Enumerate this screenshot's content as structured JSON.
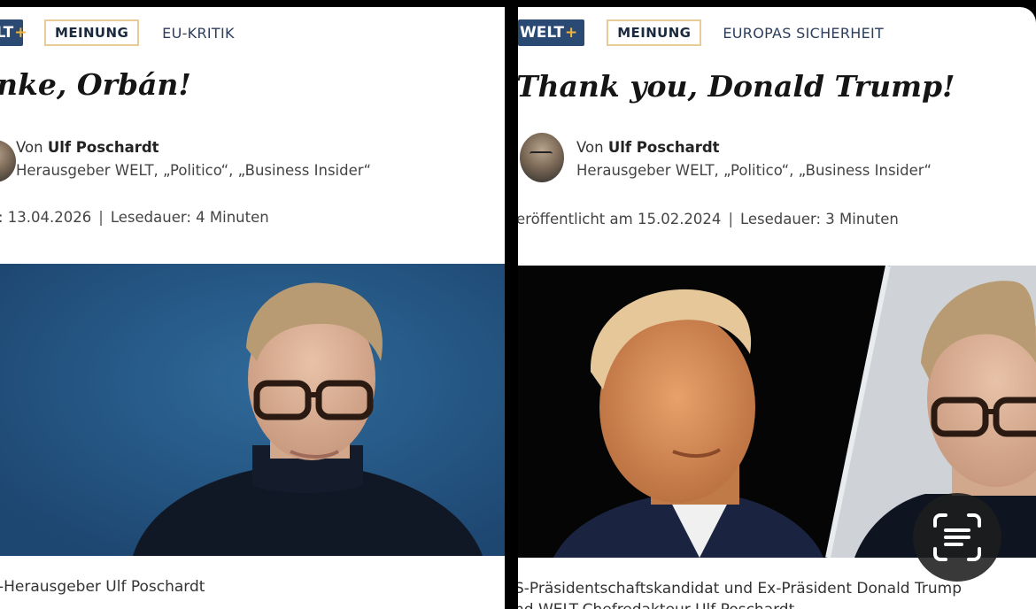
{
  "left": {
    "badge": {
      "brand": "ELT",
      "plus": "+"
    },
    "category": "MEINUNG",
    "topic": "EU-KRITIK",
    "headline": "nke, Orbán!",
    "byline": {
      "prefix": "Von",
      "author": "Ulf Poschardt",
      "role": "Herausgeber WELT, „Politico“, „Business Insider“"
    },
    "meta": {
      "published": ": 13.04.2026",
      "separator": "|",
      "reading_time": "Lesedauer: 4 Minuten"
    },
    "caption": "-Herausgeber Ulf Poschardt"
  },
  "right": {
    "badge": {
      "brand": "WELT",
      "plus": "+"
    },
    "category": "MEINUNG",
    "topic": "EUROPAS SICHERHEIT",
    "headline": "Thank you, Donald Trump!",
    "byline": {
      "prefix": "Von",
      "author": "Ulf Poschardt",
      "role": "Herausgeber WELT, „Politico“, „Business Insider“"
    },
    "meta": {
      "published": "eröffentlicht am 15.02.2024",
      "separator": "|",
      "reading_time": "Lesedauer: 3 Minuten"
    },
    "caption_line1": "S-Präsidentschaftskandidat und Ex-Präsident Donald Trump",
    "caption_line2": "nd WELT-Chefredakteur Ulf Poschardt"
  },
  "overlay": {
    "icon": "live-text-scan-icon"
  },
  "colors": {
    "welt_blue": "#2b4a73",
    "welt_plus": "#f0b43c",
    "meinung_border": "#e8cc97",
    "photo_bg_left": "#2b5a85"
  }
}
